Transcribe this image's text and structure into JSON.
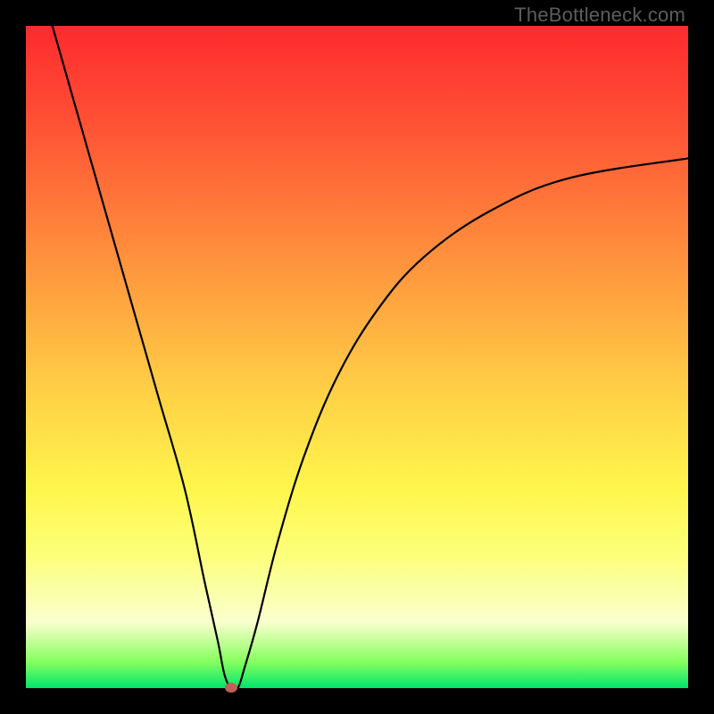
{
  "attribution": "TheBottleneck.com",
  "chart_data": {
    "type": "line",
    "title": "",
    "xlabel": "",
    "ylabel": "",
    "xlim": [
      0,
      100
    ],
    "ylim": [
      0,
      100
    ],
    "grid": false,
    "legend": false,
    "series": [
      {
        "name": "bottleneck-curve",
        "x": [
          4,
          8,
          12,
          16,
          20,
          24,
          27,
          29,
          30,
          31,
          32,
          33,
          35,
          38,
          42,
          47,
          53,
          60,
          70,
          82,
          100
        ],
        "values": [
          100,
          86,
          72,
          58,
          44,
          30,
          16,
          7,
          2,
          0,
          0,
          3,
          10,
          22,
          35,
          47,
          57,
          65,
          72,
          77,
          80
        ]
      }
    ],
    "marker": {
      "x": 31,
      "y": 0,
      "color": "#c15f59"
    },
    "background_gradient": {
      "type": "vertical",
      "stops": [
        {
          "pos": 0.0,
          "color": "#fd2a2e"
        },
        {
          "pos": 0.14,
          "color": "#fe4f34"
        },
        {
          "pos": 0.28,
          "color": "#ff7b3a"
        },
        {
          "pos": 0.42,
          "color": "#ffa740"
        },
        {
          "pos": 0.56,
          "color": "#ffd246"
        },
        {
          "pos": 0.7,
          "color": "#fff64c"
        },
        {
          "pos": 0.8,
          "color": "#fcff7a"
        },
        {
          "pos": 0.9,
          "color": "#faffcf"
        },
        {
          "pos": 0.96,
          "color": "#87ff5e"
        },
        {
          "pos": 1.0,
          "color": "#00e56c"
        }
      ]
    }
  }
}
